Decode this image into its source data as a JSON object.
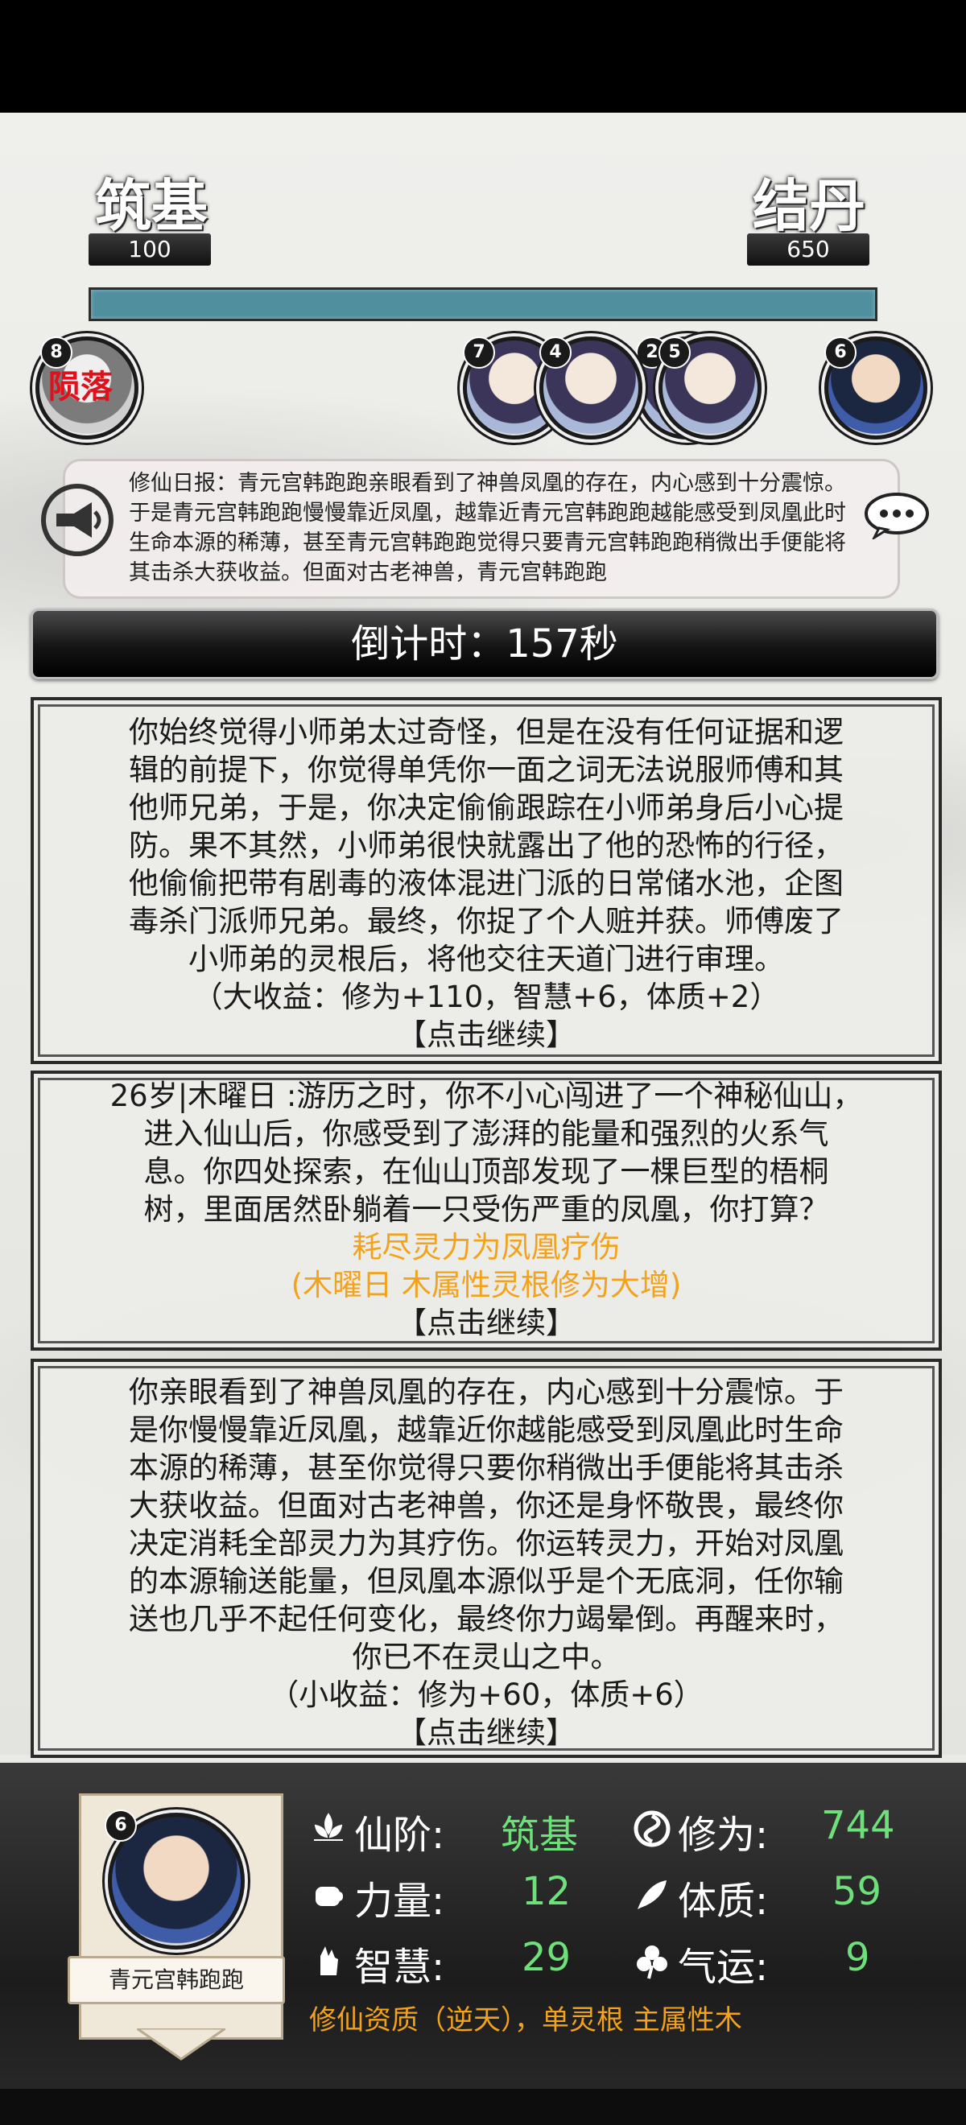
{
  "realm": {
    "current_name": "筑基",
    "current_value": "100",
    "next_name": "结丹",
    "next_value": "650"
  },
  "avatars": [
    {
      "badge": "8",
      "status": "陨落"
    },
    {
      "badge": "7"
    },
    {
      "badge": "4"
    },
    {
      "badge": "2"
    },
    {
      "badge": "5"
    },
    {
      "badge": "6"
    }
  ],
  "news": {
    "text": "修仙日报：青元宫韩跑跑亲眼看到了神兽凤凰的存在，内心感到十分震惊。于是青元宫韩跑跑慢慢靠近凤凰，越靠近青元宫韩跑跑越能感受到凤凰此时生命本源的稀薄，甚至青元宫韩跑跑觉得只要青元宫韩跑跑稍微出手便能将其击杀大获收益。但面对古老神兽，青元宫韩跑跑"
  },
  "countdown": {
    "text": "倒计时：157秒"
  },
  "cards": [
    {
      "lines": [
        "你始终觉得小师弟太过奇怪，但是在没有任何证据和逻",
        "辑的前提下，你觉得单凭你一面之词无法说服师傅和其",
        "他师兄弟，于是，你决定偷偷跟踪在小师弟身后小心提",
        "防。果不其然，小师弟很快就露出了他的恐怖的行径，",
        "他偷偷把带有剧毒的液体混进门派的日常储水池，企图",
        "毒杀门派师兄弟。最终，你捉了个人赃并获。师傅废了",
        "小师弟的灵根后，将他交往天道门进行审理。"
      ],
      "reward": "（大收益：修为+110，智慧+6，体质+2）",
      "continue": "【点击继续】"
    },
    {
      "lines": [
        "26岁|木曜日 :游历之时，你不小心闯进了一个神秘仙山，",
        "进入仙山后，你感受到了澎湃的能量和强烈的火系气",
        "息。你四处探索，在仙山顶部发现了一棵巨型的梧桐",
        "树，里面居然卧躺着一只受伤严重的凤凰，你打算？"
      ],
      "choice": "耗尽灵力为凤凰疗伤",
      "choice_note": "(木曜日 木属性灵根修为大增)",
      "continue": "【点击继续】"
    },
    {
      "lines": [
        "你亲眼看到了神兽凤凰的存在，内心感到十分震惊。于",
        "是你慢慢靠近凤凰，越靠近你越能感受到凤凰此时生命",
        "本源的稀薄，甚至你觉得只要你稍微出手便能将其击杀",
        "大获收益。但面对古老神兽，你还是身怀敬畏，最终你",
        "决定消耗全部灵力为其疗伤。你运转灵力，开始对凤凰",
        "的本源输送能量，但凤凰本源似乎是个无底洞，任你输",
        "送也几乎不起任何变化，最终你力竭晕倒。再醒来时，",
        "你已不在灵山之中。"
      ],
      "reward": "（小收益：修为+60，体质+6）",
      "continue": "【点击继续】"
    }
  ],
  "player": {
    "badge": "6",
    "name": "青元宫韩跑跑",
    "stats": {
      "rank_label": "仙阶:",
      "rank_value": "筑基",
      "cultivation_label": "修为:",
      "cultivation_value": "744",
      "strength_label": "力量:",
      "strength_value": "12",
      "constitution_label": "体质:",
      "constitution_value": "59",
      "wisdom_label": "智慧:",
      "wisdom_value": "29",
      "luck_label": "气运:",
      "luck_value": "9"
    },
    "talent": "修仙资质（逆天），单灵根 主属性木"
  },
  "colors": {
    "progress": "#4f8f9e",
    "stat_value": "#6ee07a",
    "highlight": "#f2a21b",
    "fallen": "#e0111c"
  }
}
